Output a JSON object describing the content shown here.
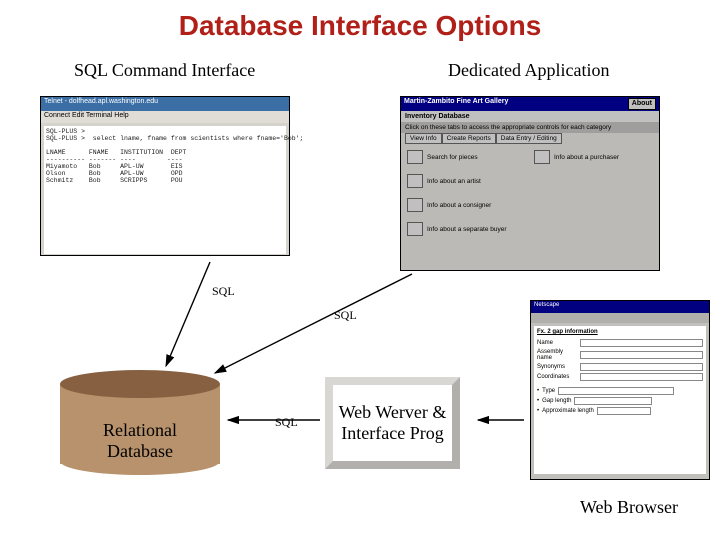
{
  "title": "Database Interface Options",
  "labels": {
    "sql_interface": "SQL Command Interface",
    "dedicated_app": "Dedicated Application",
    "web_browser": "Web Browser"
  },
  "sql_labels": {
    "a": "SQL",
    "b": "SQL",
    "c": "SQL"
  },
  "db_label": "Relational\nDatabase",
  "web_server_label": "Web Werver & Interface Prog",
  "terminal": {
    "title": "Telnet - dolfhead.apl.washington.edu",
    "menu": "Connect  Edit  Terminal  Help",
    "body": "SQL-PLUS >\nSQL-PLUS >  select lname, fname from scientists where fname='Bob';\n\nLNAME      FNAME   INSTITUTION  DEPT\n---------- ------- ----        ----\nMiyamoto   Bob     APL-UW       EIS\nOlson      Bob     APL-UW       OPD\nSchmitz    Bob     SCRIPPS      POU"
  },
  "app": {
    "title": "Martin-Zambito Fine Art Gallery",
    "about": "About",
    "subtitle": "Inventory Database",
    "hint": "Click on these tabs to access the appropriate controls for each category",
    "tabs": [
      "View Info",
      "Create Reports",
      "Data Entry / Editing"
    ],
    "rows": [
      "Search for pieces",
      "Info about a purchaser",
      "Info about an artist",
      "Info about a consigner",
      "Info about a separate buyer"
    ]
  },
  "browser": {
    "title": "Netscape",
    "heading": "Fx. 2 gap information",
    "fields": [
      "Name",
      "Assembly name",
      "Synonyms",
      "Coordinates"
    ],
    "checks": [
      "Type",
      "Gap length",
      "Approximate length"
    ]
  }
}
